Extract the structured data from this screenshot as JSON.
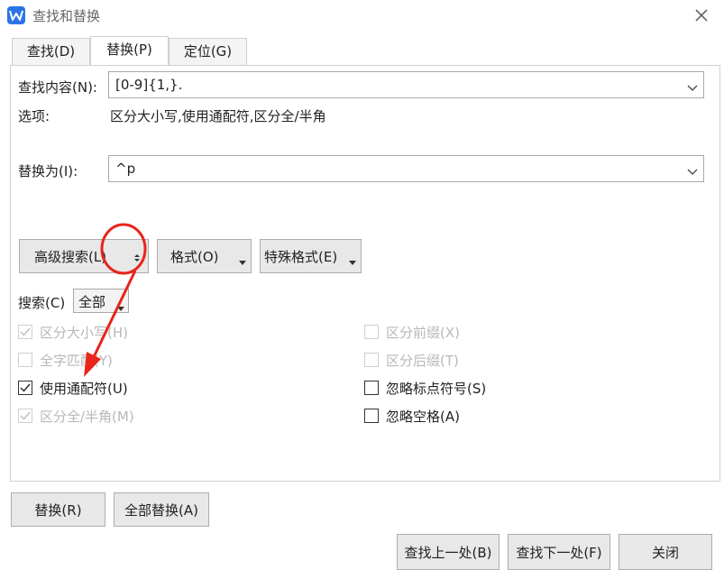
{
  "window": {
    "title": "查找和替换",
    "close_icon": "close-icon"
  },
  "tabs": [
    {
      "label": "查找(D)"
    },
    {
      "label": "替换(P)",
      "active": true
    },
    {
      "label": "定位(G)"
    }
  ],
  "find": {
    "label": "查找内容(N):",
    "value": "[0-9]{1,}."
  },
  "options": {
    "label": "选项:",
    "value": "区分大小写,使用通配符,区分全/半角"
  },
  "replace": {
    "label": "替换为(I):",
    "value": "^p"
  },
  "buttons": {
    "advanced": "高级搜索(L)",
    "format": "格式(O)",
    "special": "特殊格式(E)",
    "replace": "替换(R)",
    "replace_all": "全部替换(A)",
    "find_prev": "查找上一处(B)",
    "find_next": "查找下一处(F)",
    "close": "关闭"
  },
  "search": {
    "label": "搜索(C)",
    "value": "全部"
  },
  "checkboxes": {
    "match_case": {
      "label": "区分大小写(H)",
      "checked": true,
      "disabled": true
    },
    "whole_word": {
      "label": "全字匹配(Y)",
      "checked": false,
      "disabled": true
    },
    "wildcards": {
      "label": "使用通配符(U)",
      "checked": true,
      "disabled": false
    },
    "full_half": {
      "label": "区分全/半角(M)",
      "checked": true,
      "disabled": true
    },
    "prefix": {
      "label": "区分前缀(X)",
      "checked": false,
      "disabled": true
    },
    "suffix": {
      "label": "区分后缀(T)",
      "checked": false,
      "disabled": true
    },
    "ignore_punct": {
      "label": "忽略标点符号(S)",
      "checked": false,
      "disabled": false
    },
    "ignore_space": {
      "label": "忽略空格(A)",
      "checked": false,
      "disabled": false
    }
  },
  "colors": {
    "annotation": "#e8241b",
    "accent": "#2c74e5",
    "disabled_text": "#b8b8b8"
  }
}
